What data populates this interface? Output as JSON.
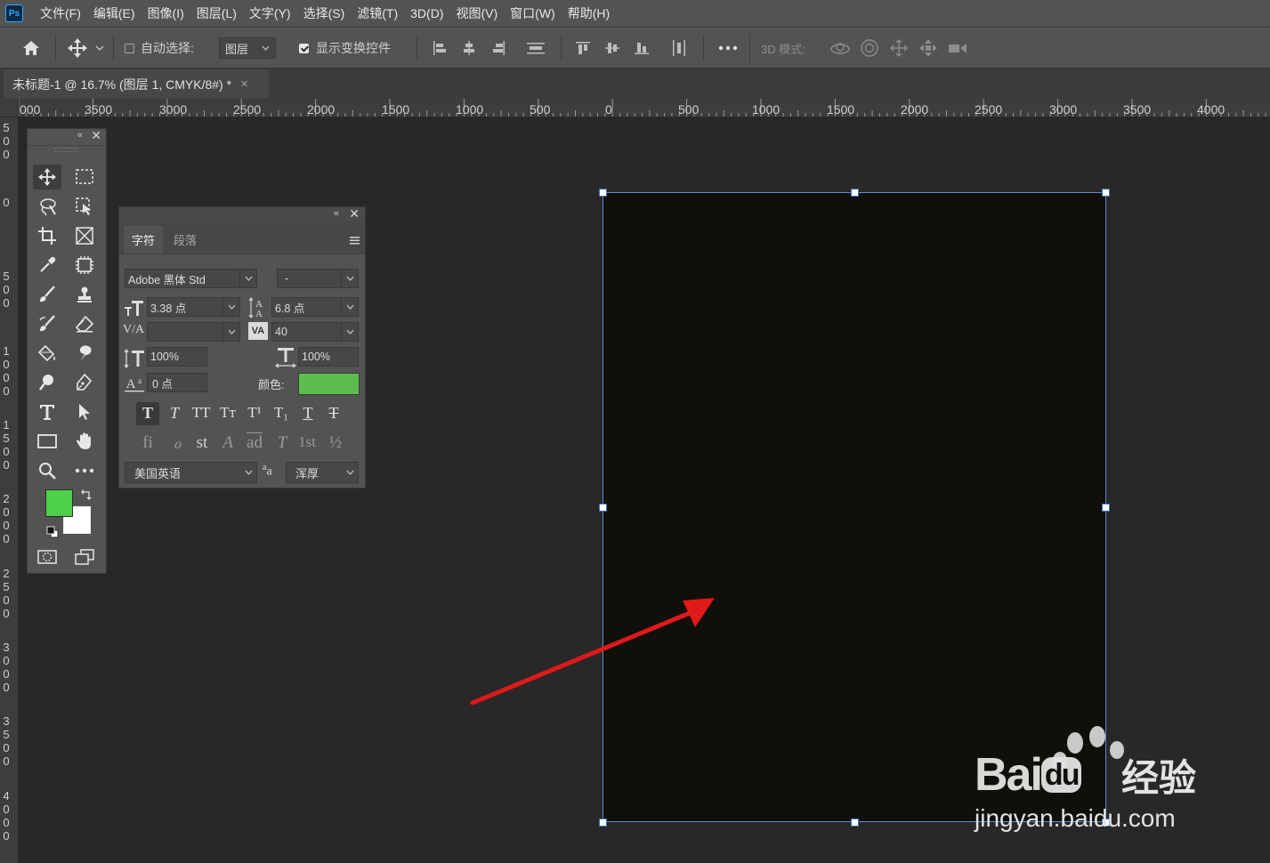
{
  "menubar": {
    "logo": "Ps",
    "items": [
      "文件(F)",
      "编辑(E)",
      "图像(I)",
      "图层(L)",
      "文字(Y)",
      "选择(S)",
      "滤镜(T)",
      "3D(D)",
      "视图(V)",
      "窗口(W)",
      "帮助(H)"
    ]
  },
  "options": {
    "auto_select_label": "自动选择:",
    "auto_select_checked": false,
    "layer_dropdown": "图层",
    "show_transform_label": "显示变换控件",
    "show_transform_checked": true,
    "mode_3d_label": "3D 模式:"
  },
  "document": {
    "tab_title": "未标题-1 @ 16.7% (图层 1, CMYK/8#) *",
    "close_glyph": "×"
  },
  "ruler": {
    "top_labels": [
      "000",
      "3500",
      "3000",
      "2500",
      "2000",
      "1500",
      "1000",
      "500",
      "0",
      "500",
      "1000",
      "1500",
      "2000",
      "2500",
      "3000",
      "3500",
      "4000"
    ],
    "left_labels": [
      [
        "5",
        "0",
        "0"
      ],
      [
        "0"
      ],
      [
        "5",
        "0",
        "0"
      ],
      [
        "1",
        "0",
        "0",
        "0"
      ],
      [
        "1",
        "5",
        "0",
        "0"
      ],
      [
        "2",
        "0",
        "0",
        "0"
      ],
      [
        "2",
        "5",
        "0",
        "0"
      ],
      [
        "3",
        "0",
        "0",
        "0"
      ],
      [
        "3",
        "5",
        "0",
        "0"
      ],
      [
        "4",
        "0",
        "0",
        "0"
      ]
    ]
  },
  "toolbox": {
    "foreground_color": "#4cd04c",
    "background_color": "#ffffff"
  },
  "character_panel": {
    "tab_character": "字符",
    "tab_paragraph": "段落",
    "font_family": "Adobe 黑体 Std",
    "font_style": "-",
    "font_size": "3.38 点",
    "leading": "6.8 点",
    "kerning": "",
    "tracking": "40",
    "vertical_scale": "100%",
    "horizontal_scale": "100%",
    "baseline_shift": "0 点",
    "color_label": "颜色:",
    "color_value": "#5bbd4c",
    "language": "美国英语",
    "aa_label": "a",
    "aa_prefix": "a",
    "antialias": "浑厚",
    "style_buttons": [
      "T",
      "T",
      "TT",
      "Tт",
      "T¹",
      "T₁",
      "T",
      "T"
    ],
    "opentype_buttons": [
      "fi",
      "ℴ",
      "st",
      "A",
      "ad",
      "T",
      "1st",
      "½"
    ]
  },
  "canvas": {
    "document_color": "#100f0a",
    "annotation_arrow_color": "#e01919"
  },
  "watermark": {
    "brand": "Bai",
    "brand_du": "du",
    "brand_cn": "经验",
    "url": "jingyan.baidu.com"
  }
}
